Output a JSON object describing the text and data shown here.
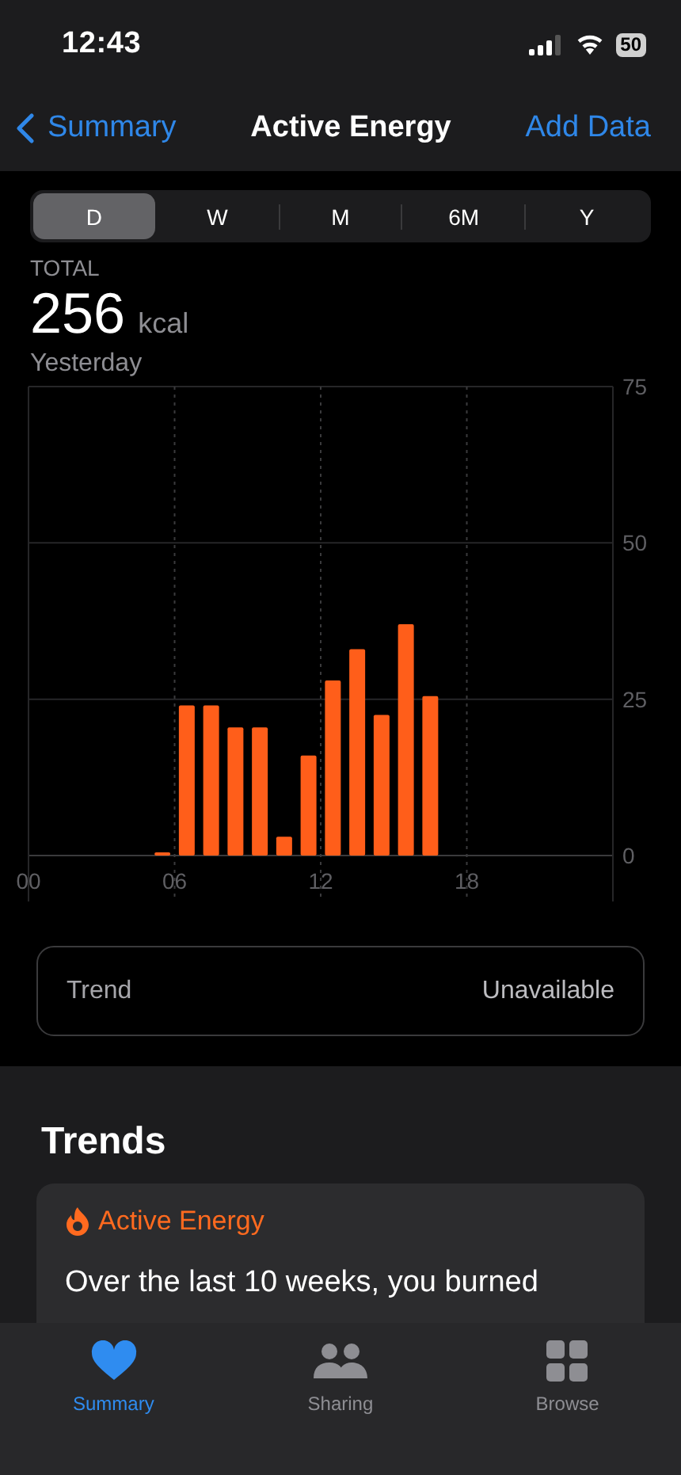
{
  "status_bar": {
    "time": "12:43",
    "battery": "50"
  },
  "nav": {
    "back": "Summary",
    "title": "Active Energy",
    "action": "Add Data"
  },
  "segments": [
    {
      "label": "D",
      "selected": true
    },
    {
      "label": "W",
      "selected": false
    },
    {
      "label": "M",
      "selected": false
    },
    {
      "label": "6M",
      "selected": false
    },
    {
      "label": "Y",
      "selected": false
    }
  ],
  "summary": {
    "label": "TOTAL",
    "value": "256",
    "unit": "kcal",
    "date": "Yesterday"
  },
  "chart_data": {
    "type": "bar",
    "grid": true,
    "x": [
      5.5,
      6.5,
      7.5,
      8.5,
      9.5,
      10.5,
      11.5,
      12.5,
      13.5,
      14.5,
      15.5,
      16.5
    ],
    "series": [
      {
        "color": "#ff5e1a",
        "values": [
          0.3,
          24,
          24,
          20.5,
          20.5,
          3,
          16,
          28,
          33,
          22.5,
          37,
          25.5
        ]
      }
    ],
    "xlim": [
      0,
      24
    ],
    "ylim": [
      0,
      75
    ],
    "xticks": [
      {
        "value": 0,
        "label": "00"
      },
      {
        "value": 6,
        "label": "06"
      },
      {
        "value": 12,
        "label": "12"
      },
      {
        "value": 18,
        "label": "18"
      }
    ],
    "yticks": [
      0,
      25,
      50,
      75
    ]
  },
  "trend": {
    "label": "Trend",
    "value": "Unavailable"
  },
  "trends_section": {
    "title": "Trends",
    "card": {
      "metric": "Active Energy",
      "text": "Over the last 10 weeks, you burned"
    }
  },
  "tab_bar": [
    {
      "label": "Summary",
      "selected": true,
      "kind": "heart"
    },
    {
      "label": "Sharing",
      "selected": false,
      "kind": "people"
    },
    {
      "label": "Browse",
      "selected": false,
      "kind": "grid"
    }
  ]
}
